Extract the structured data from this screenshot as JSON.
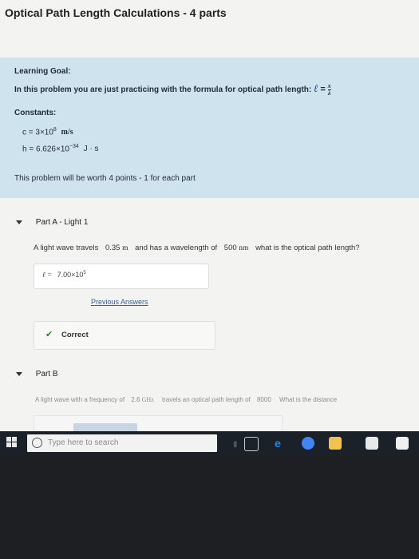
{
  "page": {
    "title": "Optical Path Length Calculations - 4 parts"
  },
  "learning_goal": {
    "heading": "Learning Goal:",
    "intro": "In this problem you are just practicing with the formula for optical path length:",
    "formula_lhs": "ℓ",
    "formula_eq": "=",
    "formula_rhs_num": "x",
    "formula_rhs_den": "λ",
    "constants_heading": "Constants:",
    "const_c": "c = 3×10",
    "const_c_exp": "8",
    "const_c_unit": "m/s",
    "const_h": "h = 6.626×10",
    "const_h_exp": "−34",
    "const_h_unit": "J · s",
    "worth": "This problem will be worth 4 points - 1 for each part"
  },
  "part_a": {
    "label": "Part A",
    "sublabel": "- Light 1",
    "q1": "A light wave travels",
    "distance": "0.35",
    "distance_unit": "m",
    "q2": "and has a wavelength of",
    "wavelength": "500",
    "wavelength_unit": "nm",
    "q3": "what is the optical path length?",
    "answer_symbol": "ℓ =",
    "answer_value": "7.00×10",
    "answer_exp": "5",
    "prev_answers": "Previous Answers",
    "correct_icon": "✔",
    "correct_label": "Correct"
  },
  "part_b": {
    "label": "Part B",
    "q1": "A light wave with a frequency of",
    "freq": "2.6",
    "freq_unit": "GHz",
    "q2": "travels an optical path length of",
    "opl": "8000",
    "q3": "What is the distance"
  },
  "taskbar": {
    "search_placeholder": "Type here to search",
    "icons": [
      "windows-start-icon",
      "search-icon",
      "microphone-icon",
      "task-view-icon",
      "edge-icon",
      "chrome-icon",
      "file-explorer-icon",
      "store-icon",
      "mail-icon"
    ]
  }
}
